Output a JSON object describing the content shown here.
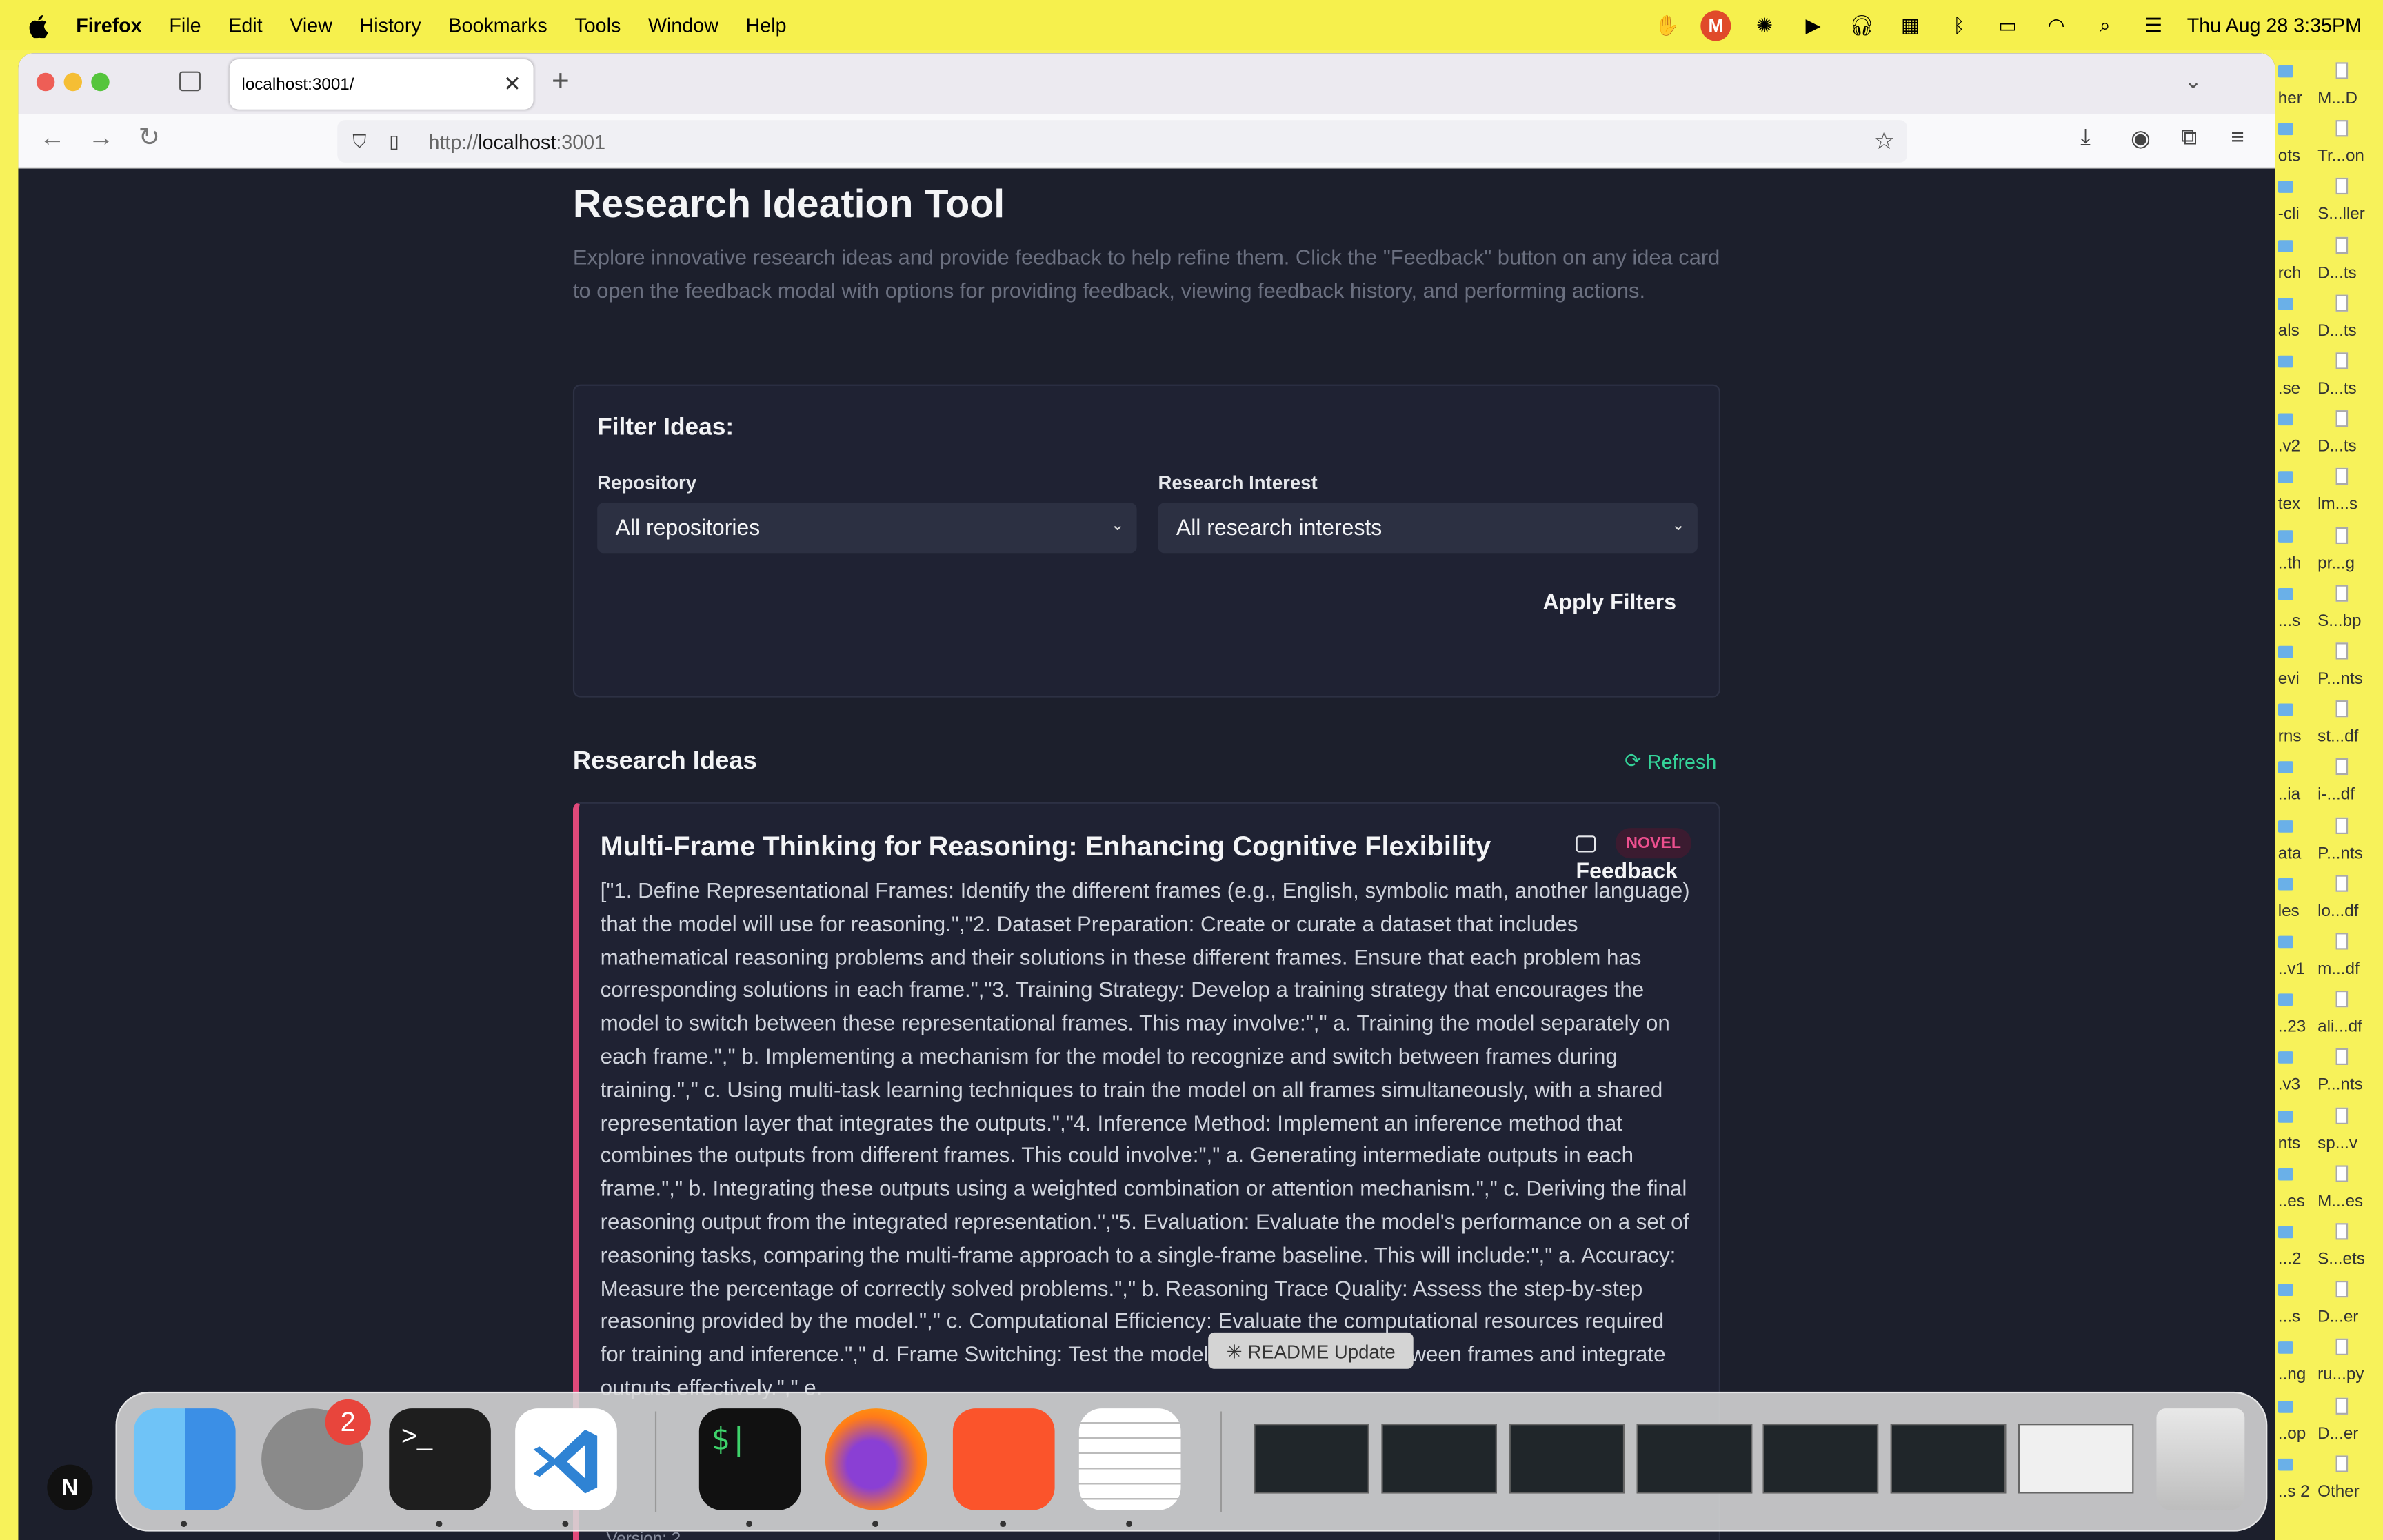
{
  "menubar": {
    "app_name": "Firefox",
    "items": [
      "File",
      "Edit",
      "View",
      "History",
      "Bookmarks",
      "Tools",
      "Window",
      "Help"
    ],
    "m_badge": "M",
    "datetime": "Thu Aug 28  3:35PM"
  },
  "browser": {
    "tab_title": "localhost:3001/",
    "url_prefix": "http://",
    "url_host": "localhost",
    "url_suffix": ":3001"
  },
  "page": {
    "title": "Research Ideation Tool",
    "description": "Explore innovative research ideas and provide feedback to help refine them. Click the \"Feedback\" button on any idea card to open the feedback modal with options for providing feedback, viewing feedback history, and performing actions.",
    "filter": {
      "title": "Filter Ideas:",
      "repository_label": "Repository",
      "repository_value": "All repositories",
      "interest_label": "Research Interest",
      "interest_value": "All research interests",
      "apply_label": "Apply Filters"
    },
    "ideas_header": "Research Ideas",
    "refresh_label": "Refresh",
    "idea": {
      "title": "Multi-Frame Thinking for Reasoning: Enhancing Cognitive Flexibility",
      "badge": "NOVEL",
      "feedback_label": "Feedback",
      "body": "[\"1. Define Representational Frames: Identify the different frames (e.g., English, symbolic math, another language) that the model will use for reasoning.\",\"2. Dataset Preparation: Create or curate a dataset that includes mathematical reasoning problems and their solutions in these different frames. Ensure that each problem has corresponding solutions in each frame.\",\"3. Training Strategy: Develop a training strategy that encourages the model to switch between these representational frames. This may involve:\",\" a. Training the model separately on each frame.\",\" b. Implementing a mechanism for the model to recognize and switch between frames during training.\",\" c. Using multi-task learning techniques to train the model on all frames simultaneously, with a shared representation layer that integrates the outputs.\",\"4. Inference Method: Implement an inference method that combines the outputs from different frames. This could involve:\",\" a. Generating intermediate outputs in each frame.\",\" b. Integrating these outputs using a weighted combination or attention mechanism.\",\" c. Deriving the final reasoning output from the integrated representation.\",\"5. Evaluation: Evaluate the model's performance on a set of reasoning tasks, comparing the multi-frame approach to a single-frame baseline. This will include:\",\" a. Accuracy: Measure the percentage of correctly solved problems.\",\" b. Reasoning Trace Quality: Assess the step-by-step reasoning provided by the model.\",\" c. Computational Efficiency: Evaluate the computational resources required for training and inference.\",\" d. Frame Switching: Test the model's ability to switch between frames and integrate outputs effectively.\",\" e.",
      "version": "Version: 2"
    },
    "tooltip": "✳ README Update"
  },
  "desktop": {
    "items": [
      {
        "l": "her",
        "r": "M...D"
      },
      {
        "l": "ots",
        "r": "Tr...on"
      },
      {
        "l": "-cli",
        "r": "S...ller"
      },
      {
        "l": "rch",
        "r": "D...ts"
      },
      {
        "l": "als",
        "r": "D...ts"
      },
      {
        "l": ".se",
        "r": "D...ts"
      },
      {
        "l": ".v2",
        "r": "D...ts"
      },
      {
        "l": "tex",
        "r": "lm...s"
      },
      {
        "l": "..th",
        "r": "pr...g"
      },
      {
        "l": "...s",
        "r": "S...bp"
      },
      {
        "l": "evi",
        "r": "P...nts"
      },
      {
        "l": "rns",
        "r": "st...df"
      },
      {
        "l": "..ia",
        "r": "i-...df"
      },
      {
        "l": "ata",
        "r": "P...nts"
      },
      {
        "l": "les",
        "r": "lo...df"
      },
      {
        "l": "..v1",
        "r": "m...df"
      },
      {
        "l": "..23",
        "r": "ali...df"
      },
      {
        "l": ".v3",
        "r": "P...nts"
      },
      {
        "l": "nts",
        "r": "sp...v"
      },
      {
        "l": "..es",
        "r": "M...es"
      },
      {
        "l": "...2",
        "r": "S...ets"
      },
      {
        "l": "...s",
        "r": "D...er"
      },
      {
        "l": "..ng",
        "r": "ru...py"
      },
      {
        "l": "..op",
        "r": "D...er"
      },
      {
        "l": "..s 2",
        "r": "Other"
      }
    ]
  },
  "dock": {
    "settings_badge": "2",
    "terminal_prompt": ">_",
    "iterm_prompt": "$|",
    "avatar_letter": "N"
  },
  "colors": {
    "accent_green": "#34d399",
    "novel_pink": "#ec4f8e",
    "card_border": "#e0497a",
    "page_bg": "#1c1f2c"
  }
}
